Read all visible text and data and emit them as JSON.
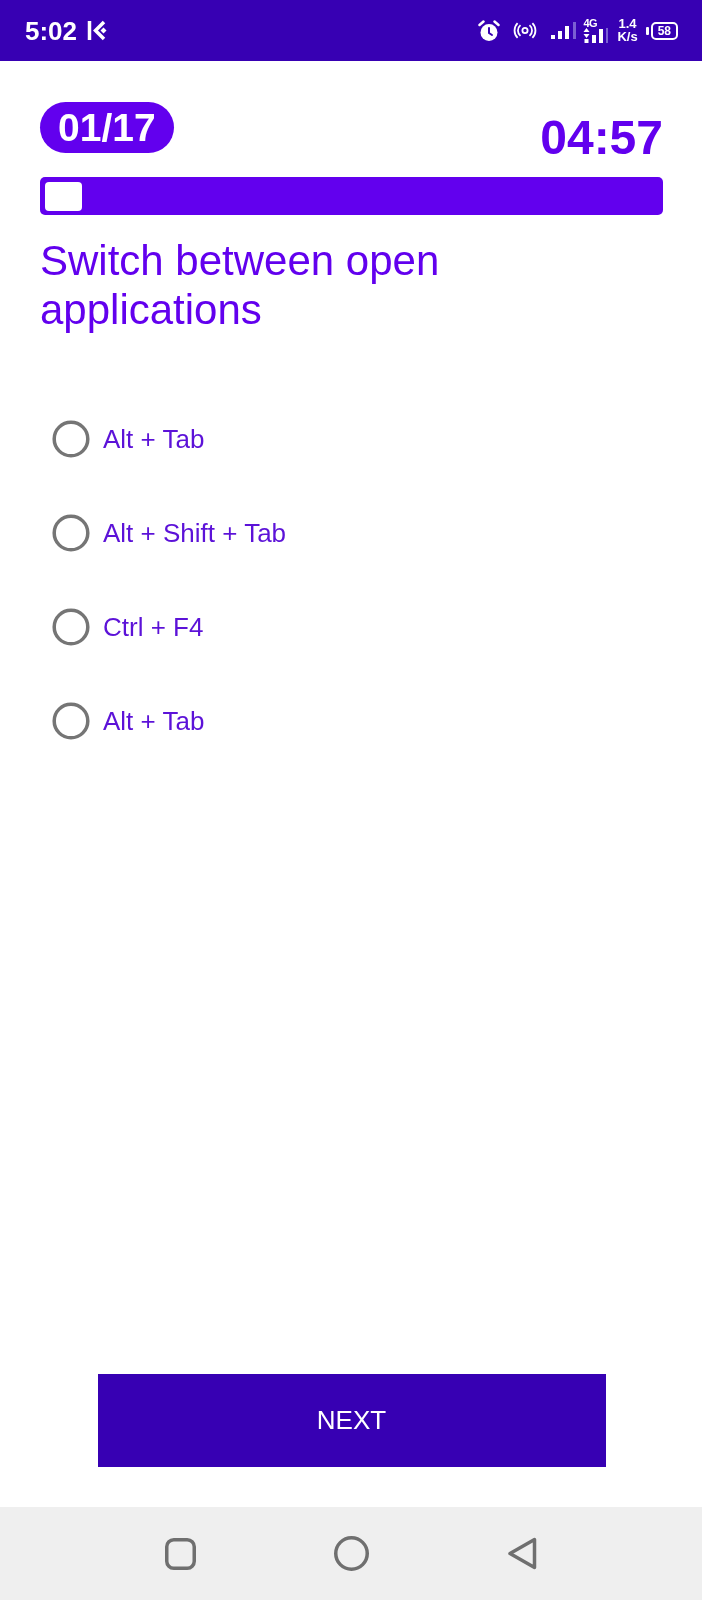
{
  "status_bar": {
    "time": "5:02",
    "network_type": "4G",
    "speed_value": "1.4",
    "speed_unit": "K/s",
    "battery": "58"
  },
  "quiz": {
    "counter": "01/17",
    "timer": "04:57",
    "progress": {
      "level": 0.06
    },
    "question": "Switch between open applications",
    "options": [
      {
        "label": "Alt + Tab",
        "selected": false
      },
      {
        "label": "Alt + Shift + Tab",
        "selected": false
      },
      {
        "label": "Ctrl + F4",
        "selected": false
      },
      {
        "label": "Alt + Tab",
        "selected": false
      }
    ]
  },
  "next_button": {
    "label": "NEXT"
  }
}
